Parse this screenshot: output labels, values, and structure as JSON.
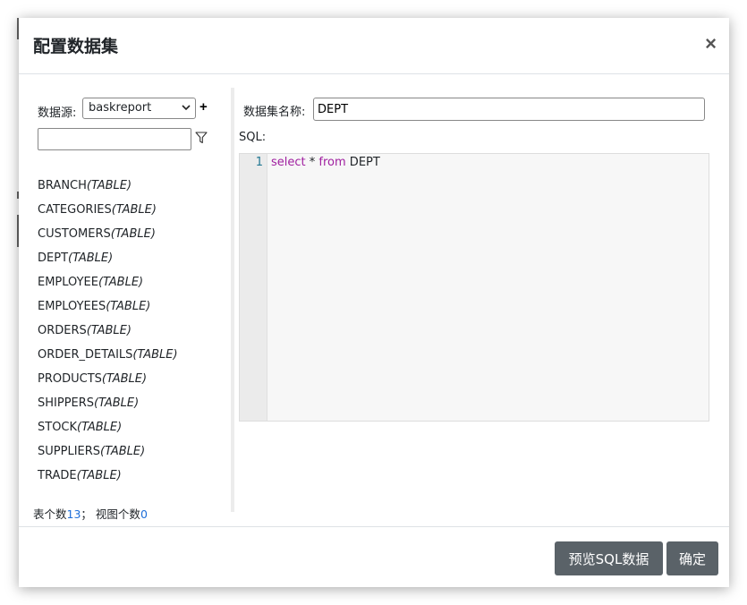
{
  "dialog": {
    "title": "配置数据集",
    "close_label": "×"
  },
  "datasource": {
    "label": "数据源:",
    "selected": "baskreport",
    "add_label": "+",
    "filter_value": ""
  },
  "tables": [
    {
      "name": "BRANCH",
      "type": "(TABLE)"
    },
    {
      "name": "CATEGORIES",
      "type": "(TABLE)"
    },
    {
      "name": "CUSTOMERS",
      "type": "(TABLE)"
    },
    {
      "name": "DEPT",
      "type": "(TABLE)"
    },
    {
      "name": "EMPLOYEE",
      "type": "(TABLE)"
    },
    {
      "name": "EMPLOYEES",
      "type": "(TABLE)"
    },
    {
      "name": "ORDERS",
      "type": "(TABLE)"
    },
    {
      "name": "ORDER_DETAILS",
      "type": "(TABLE)"
    },
    {
      "name": "PRODUCTS",
      "type": "(TABLE)"
    },
    {
      "name": "SHIPPERS",
      "type": "(TABLE)"
    },
    {
      "name": "STOCK",
      "type": "(TABLE)"
    },
    {
      "name": "SUPPLIERS",
      "type": "(TABLE)"
    },
    {
      "name": "TRADE",
      "type": "(TABLE)"
    }
  ],
  "stats": {
    "table_label": "表个数",
    "table_count": "13",
    "separator": "；",
    "view_label": "视图个数",
    "view_count": "0"
  },
  "dataset": {
    "name_label": "数据集名称:",
    "name_value": "DEPT",
    "sql_label": "SQL:"
  },
  "editor": {
    "line_number": "1",
    "tokens": {
      "t1": "select",
      "t2": " * ",
      "t3": "from",
      "t4": " DEPT"
    }
  },
  "footer": {
    "preview_label": "预览SQL数据",
    "ok_label": "确定"
  },
  "colors": {
    "keyword": "#a020a0",
    "count_link": "#1e6fd9",
    "button": "#5a6268"
  }
}
